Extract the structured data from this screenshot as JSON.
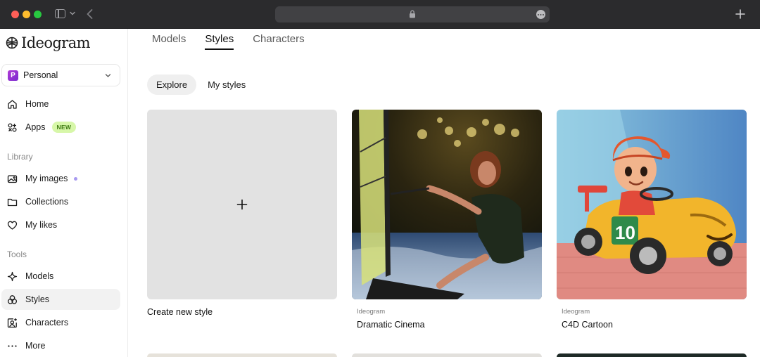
{
  "browser": {
    "icons": [
      "sidebar-toggle-icon",
      "chevron-down-icon",
      "back-arrow-icon",
      "lock-icon",
      "more-icon",
      "new-tab-plus-icon"
    ]
  },
  "sidebar": {
    "logo_text": "Ideogram",
    "workspace": {
      "avatar_letter": "P",
      "label": "Personal",
      "avatar_color": "#9b34d4"
    },
    "nav_primary": [
      {
        "label": "Home",
        "icon": "home-icon"
      },
      {
        "label": "Apps",
        "icon": "apps-icon",
        "badge": "NEW"
      }
    ],
    "library_label": "Library",
    "nav_library": [
      {
        "label": "My images",
        "icon": "images-icon"
      },
      {
        "label": "Collections",
        "icon": "folder-icon"
      },
      {
        "label": "My likes",
        "icon": "heart-icon"
      }
    ],
    "tools_label": "Tools",
    "nav_tools": [
      {
        "label": "Models",
        "icon": "sparkle-icon"
      },
      {
        "label": "Styles",
        "icon": "styles-icon",
        "active": true
      },
      {
        "label": "Characters",
        "icon": "characters-icon"
      },
      {
        "label": "More",
        "icon": "more-horizontal-icon"
      }
    ]
  },
  "main": {
    "tabs": [
      {
        "label": "Models"
      },
      {
        "label": "Styles",
        "active": true
      },
      {
        "label": "Characters"
      }
    ],
    "subtabs": [
      {
        "label": "Explore",
        "active": true
      },
      {
        "label": "My styles"
      }
    ],
    "create_card": {
      "title": "Create new style"
    },
    "style_cards": [
      {
        "author": "Ideogram",
        "title": "Dramatic Cinema"
      },
      {
        "author": "Ideogram",
        "title": "C4D Cartoon"
      }
    ]
  },
  "colors": {
    "accent_active_bg": "#f2f2f2",
    "new_badge_bg": "#d7f7a9",
    "new_badge_text": "#3c7a10",
    "dot_purple": "#a89af0"
  }
}
